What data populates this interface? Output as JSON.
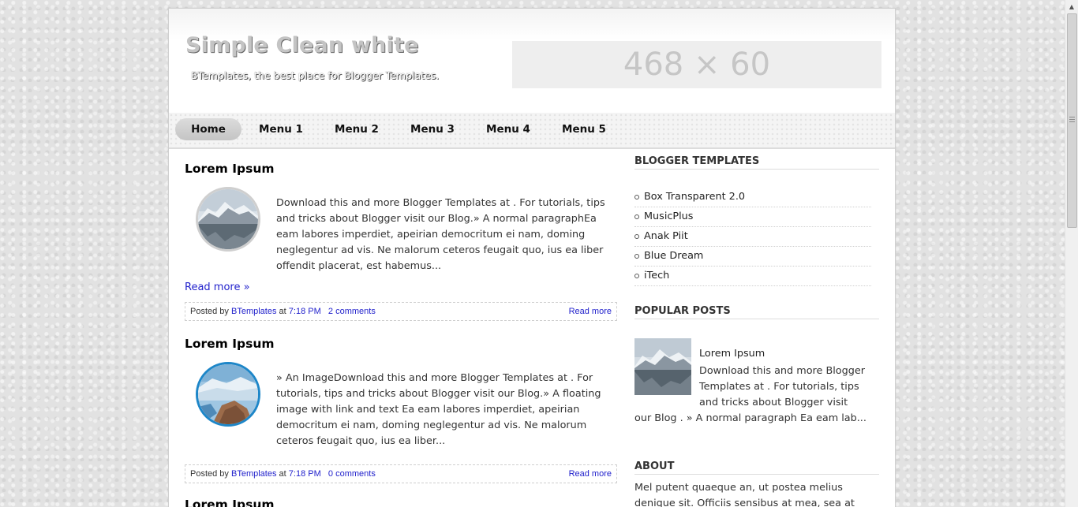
{
  "header": {
    "title": "Simple Clean white",
    "description": "BTemplates, the best place for Blogger Templates.",
    "ad_banner": "468 × 60"
  },
  "nav": {
    "items": [
      {
        "label": "Home"
      },
      {
        "label": "Menu 1"
      },
      {
        "label": "Menu 2"
      },
      {
        "label": "Menu 3"
      },
      {
        "label": "Menu 4"
      },
      {
        "label": "Menu 5"
      }
    ]
  },
  "posts": [
    {
      "title": "Lorem Ipsum",
      "body": "Download this and more Blogger Templates at . For tutorials, tips and tricks about Blogger visit our Blog.» A normal paragraphEa eam labores imperdiet, apeirian democritum ei nam, doming neglegentur ad vis. Ne malorum ceteros feugait quo, ius ea liber offendit placerat, est habemus...",
      "read_more": "Read more »",
      "posted_by": "Posted by",
      "author": "BTemplates",
      "at": "at",
      "time": "7:18 PM",
      "comments": "2 comments",
      "footer_read_more": "Read more"
    },
    {
      "title": "Lorem Ipsum",
      "body": "» An ImageDownload this and more Blogger Templates at . For tutorials, tips and tricks about Blogger visit our Blog.» A floating image with link and text Ea eam labores imperdiet, apeirian democritum ei nam, doming neglegentur ad vis. Ne malorum ceteros feugait quo, ius ea liber...",
      "posted_by": "Posted by",
      "author": "BTemplates",
      "at": "at",
      "time": "7:18 PM",
      "comments": "0 comments",
      "footer_read_more": "Read more"
    },
    {
      "title": "Lorem Ipsum"
    }
  ],
  "sidebar": {
    "templates_title": "BLOGGER TEMPLATES",
    "templates": [
      {
        "label": "Box Transparent 2.0"
      },
      {
        "label": "MusicPlus"
      },
      {
        "label": "Anak Piit"
      },
      {
        "label": "Blue Dream"
      },
      {
        "label": "iTech"
      }
    ],
    "popular_title": "POPULAR POSTS",
    "popular": {
      "title": "Lorem Ipsum",
      "text_line1": "Download this and more Blogger",
      "text_line2": "Templates at . For tutorials, tips",
      "text_line3": "and tricks about Blogger visit",
      "text_rest": "our Blog . » A normal paragraph Ea eam lab..."
    },
    "about_title": "ABOUT",
    "about_text": "Mel putent quaeque an, ut postea melius denique sit. Officiis sensibus at mea, sea at"
  },
  "colors": {
    "link": "#2222cc",
    "thumb_blue_border": "#1d86c8",
    "page_background": "#e2e2e2"
  }
}
